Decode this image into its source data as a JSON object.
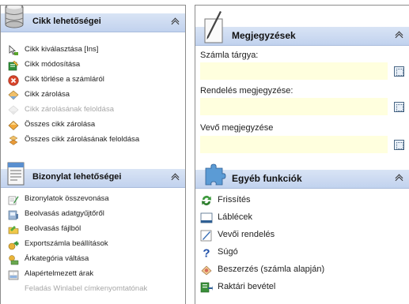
{
  "left_panel": {
    "cikk_section": {
      "title": "Cikk lehetőségei",
      "icon": "database-icon",
      "items": [
        {
          "label": "Cikk kiválasztása [Ins]",
          "icon": "pointer-select-icon",
          "enabled": true
        },
        {
          "label": "Cikk módosítása",
          "icon": "edit-sheet-icon",
          "enabled": true
        },
        {
          "label": "Cikk törlése a számláról",
          "icon": "delete-x-icon",
          "enabled": true
        },
        {
          "label": "Cikk zárolása",
          "icon": "lock-tag-icon",
          "enabled": true
        },
        {
          "label": "Cikk zárolásának feloldása",
          "icon": "unlock-tag-icon",
          "enabled": false
        },
        {
          "label": "Összes cikk zárolása",
          "icon": "lock-all-icon",
          "enabled": true
        },
        {
          "label": "Összes cikk zárolásának feloldása",
          "icon": "unlock-all-icon",
          "enabled": true
        }
      ]
    },
    "bizonylat_section": {
      "title": "Bizonylat lehetőségei",
      "icon": "document-icon",
      "items": [
        {
          "label": "Bizonylatok összevonása",
          "icon": "merge-pen-icon",
          "enabled": true
        },
        {
          "label": "Beolvasás adatgyűjtőről",
          "icon": "scanner-icon",
          "enabled": true
        },
        {
          "label": "Beolvasás fájlból",
          "icon": "open-file-icon",
          "enabled": true
        },
        {
          "label": "Exportszámla beállítások",
          "icon": "export-money-icon",
          "enabled": true
        },
        {
          "label": "Árkategória váltása",
          "icon": "price-category-icon",
          "enabled": true
        },
        {
          "label": "Alapértelmezett árak",
          "icon": "default-price-icon",
          "enabled": true
        },
        {
          "label": "Feladás Winlabel címkenyomtatónak",
          "icon": "label-printer-icon",
          "enabled": false
        }
      ]
    }
  },
  "right_panel": {
    "megjegyzesek_section": {
      "title": "Megjegyzések",
      "icon": "pen-note-icon",
      "fields": [
        {
          "label": "Számla tárgya:",
          "value": ""
        },
        {
          "label": "Rendelés megjegyzése:",
          "value": ""
        },
        {
          "label": "Vevő megjegyzése",
          "value": ""
        }
      ]
    },
    "egyeb_section": {
      "title": "Egyéb funkciók",
      "icon": "puzzle-icon",
      "items": [
        {
          "label": "Frissítés",
          "icon": "refresh-icon"
        },
        {
          "label": "Láblécek",
          "icon": "footer-icon"
        },
        {
          "label": "Vevői rendelés",
          "icon": "customer-order-icon"
        },
        {
          "label": "Súgó",
          "icon": "help-icon"
        },
        {
          "label": "Beszerzés (számla alapján)",
          "icon": "purchase-icon"
        },
        {
          "label": "Raktári bevétel",
          "icon": "warehouse-receipt-icon"
        }
      ]
    }
  },
  "colors": {
    "header_top": "#d9e4f5",
    "header_bottom": "#c1d2ee",
    "field_bg": "#ffffde",
    "disabled_text": "#a7a7a7"
  }
}
